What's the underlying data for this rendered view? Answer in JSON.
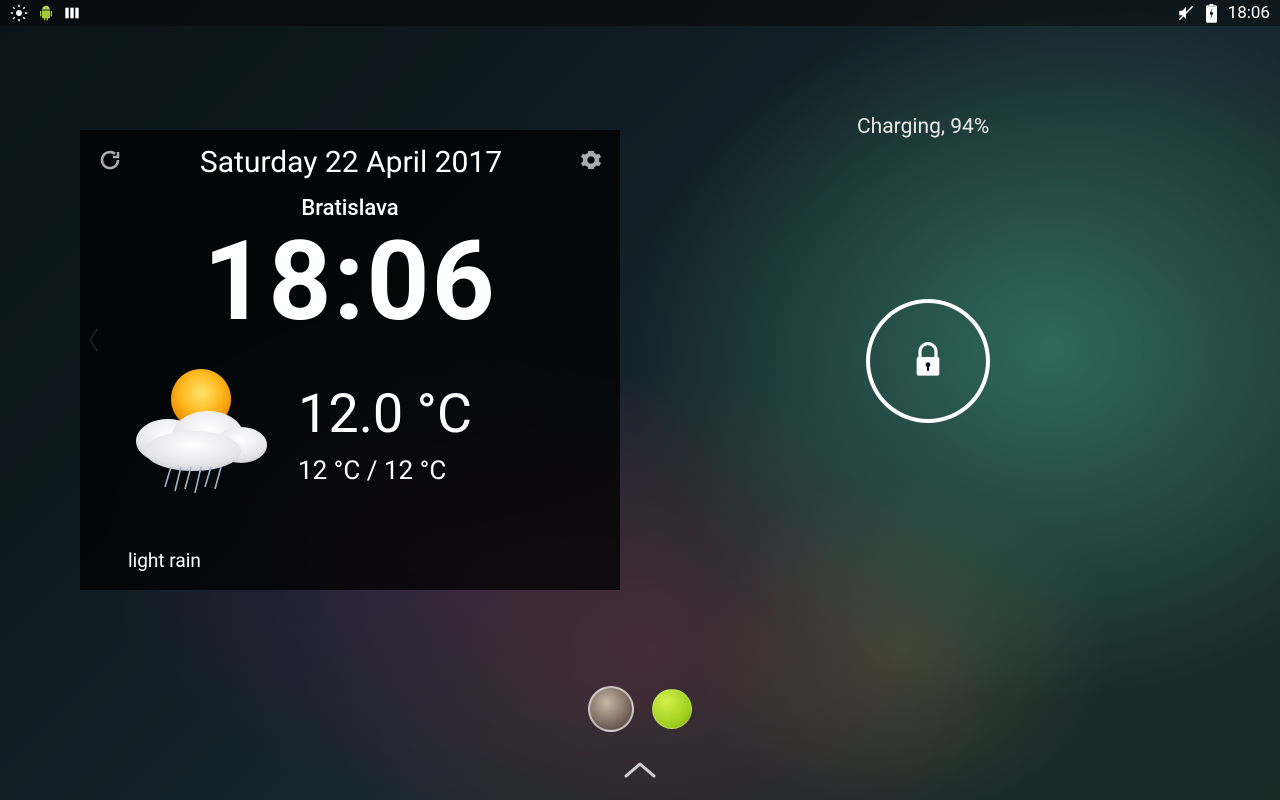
{
  "status_bar": {
    "time": "18:06",
    "icons_left": [
      "brightness-icon",
      "android-debug-icon",
      "bars-icon"
    ],
    "icons_right": [
      "mute-icon",
      "battery-charging-icon"
    ]
  },
  "charging_text": "Charging, 94%",
  "lock": {
    "label": "lock"
  },
  "widget": {
    "date": "Saturday 22 April 2017",
    "city": "Bratislava",
    "time": "18:06",
    "temp": "12.0 °C",
    "range": "12 °C / 12 °C",
    "description": "light rain",
    "icon": "sun-cloud-rain-icon"
  },
  "users": [
    {
      "kind": "avatar"
    },
    {
      "kind": "dot"
    }
  ]
}
